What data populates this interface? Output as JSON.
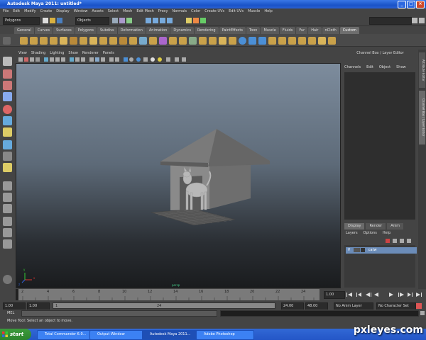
{
  "window": {
    "title": "Autodesk Maya 2011: untitled*"
  },
  "menubar": [
    "File",
    "Edit",
    "Modify",
    "Create",
    "Display",
    "Window",
    "Assets",
    "Select",
    "Mesh",
    "Edit Mesh",
    "Proxy",
    "Normals",
    "Color",
    "Create UVs",
    "Edit UVs",
    "Muscle",
    "Help"
  ],
  "statusline": {
    "mode": "Polygons",
    "select_type": "Objects"
  },
  "shelf": {
    "tabs": [
      "General",
      "Curves",
      "Surfaces",
      "Polygons",
      "Subdivs",
      "Deformation",
      "Animation",
      "Dynamics",
      "Rendering",
      "PaintEffects",
      "Toon",
      "Muscle",
      "Fluids",
      "Fur",
      "Hair",
      "nCloth",
      "Custom"
    ],
    "active": "Custom"
  },
  "viewport": {
    "menu": [
      "View",
      "Shading",
      "Lighting",
      "Show",
      "Renderer",
      "Panels"
    ],
    "camera": "persp",
    "axis": {
      "x": "x",
      "y": "y",
      "z": "z"
    }
  },
  "channelbox": {
    "title": "Channel Box / Layer Editor",
    "menu": [
      "Channels",
      "Edit",
      "Object",
      "Show"
    ]
  },
  "sidetabs": [
    "Attribute Editor",
    "Channel Box / Layer Editor"
  ],
  "layers": {
    "tabs": [
      "Display",
      "Render",
      "Anim"
    ],
    "menu": [
      "Layers",
      "Options",
      "Help"
    ],
    "rows": [
      {
        "v": "V",
        "name": "catw"
      }
    ]
  },
  "timeslider": {
    "ticks": [
      "2",
      "4",
      "6",
      "8",
      "10",
      "12",
      "14",
      "16",
      "18",
      "20",
      "22",
      "24"
    ],
    "current_frame": "1.00"
  },
  "range": {
    "start": "1.00",
    "playback_start": "1.00",
    "slider_start": "1",
    "slider_end": "24",
    "playback_end": "24.00",
    "end": "48.00",
    "anim_layer": "No Anim Layer",
    "char_set": "No Character Set"
  },
  "cmdline": {
    "label": "MEL"
  },
  "helpline": {
    "text": "Move Tool: Select an object to move."
  },
  "taskbar": {
    "start": "start",
    "tasks": [
      "Total Commander 6.0...",
      "Output Window",
      "Autodesk Maya 2011...",
      "Adobe Photoshop"
    ],
    "active_index": 2
  },
  "watermark": "pxleyes.com",
  "colors": {
    "accent": "#6b8cb8",
    "viewport_top": "#7d8c9d",
    "viewport_bottom": "#1a1c1e"
  }
}
